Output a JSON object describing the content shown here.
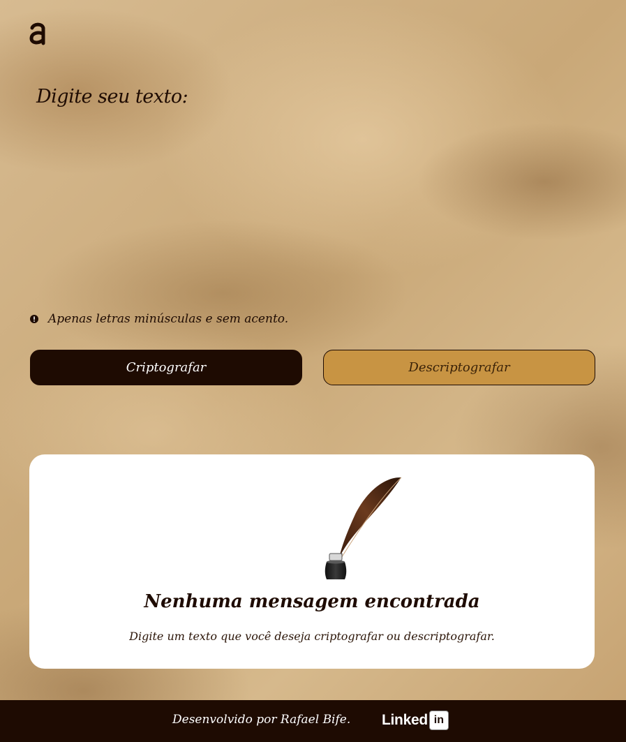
{
  "brand": {
    "logo_icon": "alura-logo-icon"
  },
  "input": {
    "placeholder": "Digite seu texto:",
    "value": ""
  },
  "notice": {
    "icon": "exclamation-circle-icon",
    "text": "Apenas letras minúsculas e sem acento."
  },
  "actions": {
    "encrypt_label": "Criptografar",
    "decrypt_label": "Descriptografar"
  },
  "output": {
    "image": "quill-inkwell-illustration",
    "title": "Nenhuma mensagem encontrada",
    "description": "Digite um texto que você deseja criptografar ou descriptografar."
  },
  "footer": {
    "credit": "Desenvolvido por Rafael Bife.",
    "linkedin_word": "Linked",
    "linkedin_box": "in",
    "linkedin_icon": "linkedin-logo-icon"
  },
  "colors": {
    "dark_brown": "#1e0b02",
    "gold": "#c89443",
    "card": "#ffffff",
    "parchment": "#d2b48c"
  }
}
